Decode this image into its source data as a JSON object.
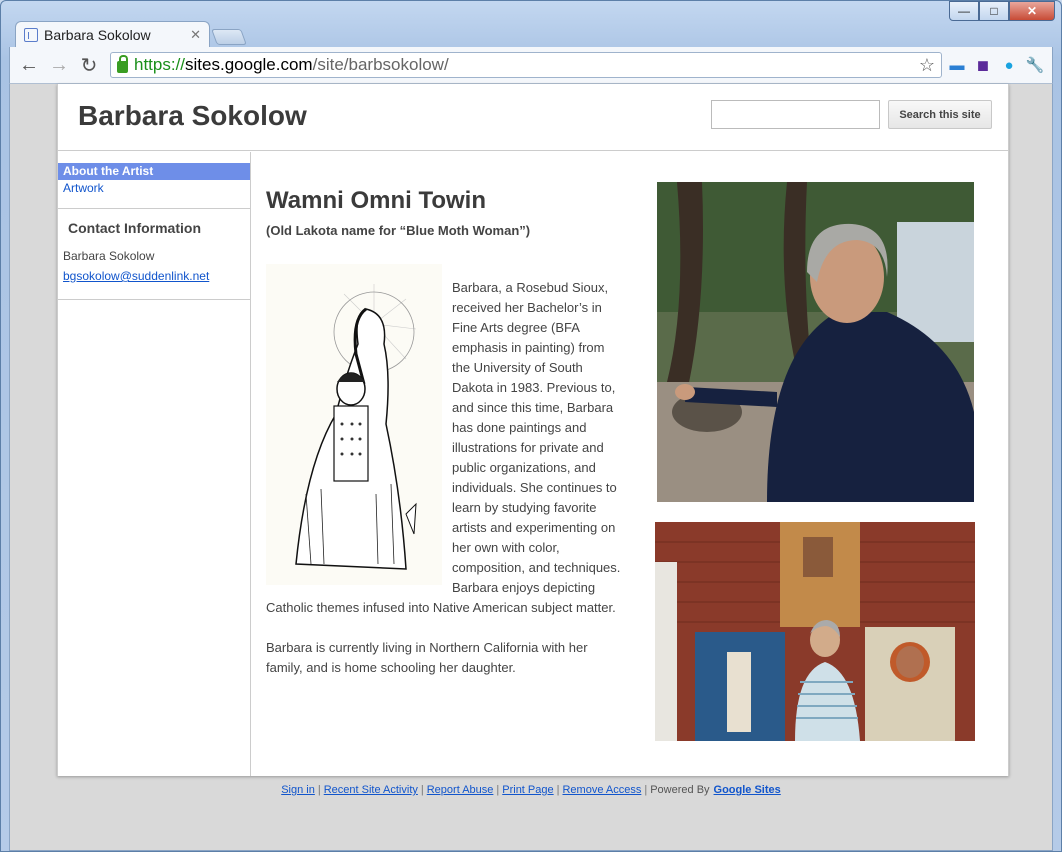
{
  "browser": {
    "tab_title": "Barbara Sokolow",
    "url_scheme": "https://",
    "url_host": "sites.google.com",
    "url_path": "/site/barbsokolow/"
  },
  "site": {
    "title": "Barbara Sokolow",
    "search_button": "Search this site",
    "search_value": ""
  },
  "sidebar": {
    "items": [
      {
        "label": "About the Artist"
      },
      {
        "label": "Artwork"
      }
    ],
    "contact_title": "Contact Information",
    "contact_name": "Barbara Sokolow",
    "contact_email": "bgsokolow@suddenlink.net"
  },
  "main": {
    "heading": "Wamni Omni Towin",
    "subheading": "(Old Lakota name for “Blue Moth Woman”)",
    "bio_p1": "Barbara, a Rosebud Sioux, received her Bachelor’s in Fine Arts degree (BFA emphasis in painting) from the University of South Dakota in 1983.  Previous to, and since this time, Barbara has done paintings and illustrations for private and public organizations, and individuals.  She continues to learn by studying favorite artists and experimenting on her own with color, composition, and techniques.  Barbara enjoys depicting Catholic themes infused into Native American subject matter.",
    "bio_p2": "Barbara is currently living in Northern California with her family, and is home schooling her daughter."
  },
  "footer": {
    "sign_in": "Sign in",
    "recent_activity": "Recent Site Activity",
    "report_abuse": "Report Abuse",
    "print_page": "Print Page",
    "remove_access": "Remove Access",
    "powered_by": "Powered By",
    "google_sites": "Google Sites"
  }
}
